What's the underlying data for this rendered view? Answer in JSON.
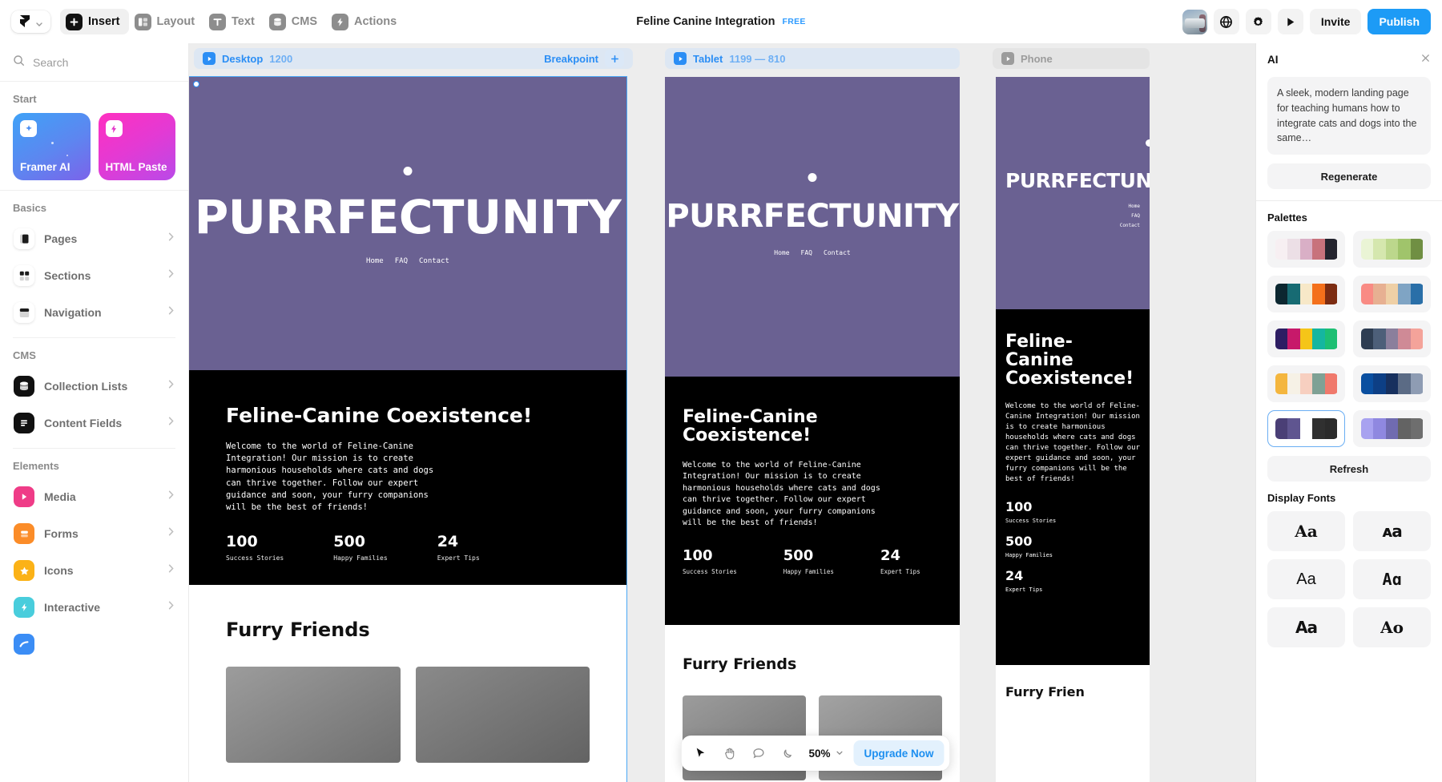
{
  "toolbar": {
    "logo_name": "framer-logo",
    "items": [
      {
        "label": "Insert",
        "icon": "plus-square-icon",
        "active": true
      },
      {
        "label": "Layout",
        "icon": "layout-icon",
        "active": false
      },
      {
        "label": "Text",
        "icon": "text-icon",
        "active": false
      },
      {
        "label": "CMS",
        "icon": "database-icon",
        "active": false
      },
      {
        "label": "Actions",
        "icon": "lightning-icon",
        "active": false
      }
    ],
    "doc_title": "Feline Canine Integration",
    "plan_badge": "FREE",
    "invite_label": "Invite",
    "publish_label": "Publish",
    "right_icons": [
      "avatar",
      "globe-icon",
      "gear-icon",
      "play-icon"
    ]
  },
  "sidebar": {
    "search_placeholder": "Search",
    "sections": [
      {
        "title": "Start",
        "type": "cards",
        "cards": [
          {
            "label": "Framer AI",
            "icon": "sparkle-icon",
            "color": "#4d8ff2"
          },
          {
            "label": "HTML Paste",
            "icon": "lightning-icon",
            "color": "#e336c8"
          }
        ]
      },
      {
        "title": "Basics",
        "type": "list",
        "items": [
          {
            "label": "Pages",
            "icon": "pages-icon",
            "color": "#ffffff"
          },
          {
            "label": "Sections",
            "icon": "sections-icon",
            "color": "#ffffff"
          },
          {
            "label": "Navigation",
            "icon": "navigation-icon",
            "color": "#ffffff"
          }
        ]
      },
      {
        "title": "CMS",
        "type": "list",
        "items": [
          {
            "label": "Collection Lists",
            "icon": "collection-icon",
            "color": "#111111"
          },
          {
            "label": "Content Fields",
            "icon": "content-fields-icon",
            "color": "#111111"
          }
        ]
      },
      {
        "title": "Elements",
        "type": "list",
        "items": [
          {
            "label": "Media",
            "icon": "media-play-icon",
            "color": "#ef3c87"
          },
          {
            "label": "Forms",
            "icon": "forms-icon",
            "color": "#fb8c28"
          },
          {
            "label": "Icons",
            "icon": "star-icon",
            "color": "#fbb217"
          },
          {
            "label": "Interactive",
            "icon": "lightning-icon",
            "color": "#49cddc"
          },
          {
            "label": "",
            "icon": "partial-icon",
            "color": "#3b8df5"
          }
        ]
      }
    ]
  },
  "canvas": {
    "breakpoints": [
      {
        "name": "Desktop",
        "size": "1200",
        "state": "active"
      },
      {
        "name": "Tablet",
        "size": "1199 — 810",
        "state": "active"
      },
      {
        "name": "Phone",
        "size": "",
        "state": "muted"
      }
    ],
    "breakpoint_add_label": "Breakpoint",
    "page": {
      "hero_title": "PURRFECTUNITY",
      "nav": [
        "Home",
        "FAQ",
        "Contact"
      ],
      "heading": "Feline-Canine Coexistence!",
      "heading_tablet_line1": "Feline-Canine",
      "heading_tablet_line2": "Coexistence!",
      "heading_phone": "Feline-Canine Coexistence!",
      "body": "Welcome to the world of Feline-Canine Integration! Our mission is to create harmonious households where cats and dogs can thrive together. Follow our expert guidance and soon, your furry companions will be the best of friends!",
      "stats": [
        {
          "number": "100",
          "label": "Success Stories"
        },
        {
          "number": "500",
          "label": "Happy Families"
        },
        {
          "number": "24",
          "label": "Expert Tips"
        }
      ],
      "section_heading": "Furry Friends",
      "section_heading_phone": "Furry Frien"
    }
  },
  "float_toolbar": {
    "tools": [
      {
        "name": "cursor-icon",
        "active": true
      },
      {
        "name": "hand-icon",
        "active": false
      },
      {
        "name": "comment-icon",
        "active": false
      },
      {
        "name": "moon-icon",
        "active": false
      }
    ],
    "zoom_value": "50%",
    "upgrade_label": "Upgrade Now"
  },
  "ai_panel": {
    "title": "AI",
    "close_icon": "close-icon",
    "prompt_text": "A sleek, modern landing page for teaching humans how to integrate cats and dogs into the same…",
    "regenerate_label": "Regenerate",
    "palettes_title": "Palettes",
    "refresh_label": "Refresh",
    "fonts_title": "Display Fonts",
    "palettes": [
      {
        "colors": [
          "#f7eff2",
          "#ecdfe6",
          "#d9afc6",
          "#c8727c",
          "#24242e"
        ],
        "selected": false
      },
      {
        "colors": [
          "#eaf4d5",
          "#d5e7ae",
          "#bcd78c",
          "#a0c46b",
          "#708f43"
        ],
        "selected": false
      },
      {
        "colors": [
          "#0c2730",
          "#176b73",
          "#f7e8c8",
          "#f4701b",
          "#7c2c12"
        ],
        "selected": false
      },
      {
        "colors": [
          "#f98b84",
          "#e7b092",
          "#efd0a6",
          "#7fa4c4",
          "#2a6fa8"
        ],
        "selected": false
      },
      {
        "colors": [
          "#2d1d63",
          "#c7196a",
          "#f5c518",
          "#15b6a0",
          "#1dbf73"
        ],
        "selected": false
      },
      {
        "colors": [
          "#2e3d52",
          "#4d5f79",
          "#8b7f9c",
          "#cf8a96",
          "#f4a39a"
        ],
        "selected": false
      },
      {
        "colors": [
          "#f4b63f",
          "#f6f1e6",
          "#f7cfc0",
          "#7fa195",
          "#f0796c"
        ],
        "selected": false
      },
      {
        "colors": [
          "#0a4fa0",
          "#0d3f85",
          "#17305e",
          "#5b6b85",
          "#8e9cb3"
        ],
        "selected": false
      },
      {
        "colors": [
          "#4a3f76",
          "#5f5590",
          "#ffffff",
          "#303030",
          "#2b2b2b"
        ],
        "selected": true
      },
      {
        "colors": [
          "#a8a2f0",
          "#8f88e0",
          "#706bb0",
          "#636363",
          "#6e6e6e"
        ],
        "selected": false
      }
    ],
    "fonts": [
      {
        "sample": "Aa",
        "style": "serif"
      },
      {
        "sample": "ᴀa",
        "style": "black"
      },
      {
        "sample": "Aa",
        "style": "sans"
      },
      {
        "sample": "Aɑ",
        "style": "display"
      },
      {
        "sample": "Aa",
        "style": "heavy"
      },
      {
        "sample": "Ao",
        "style": "light"
      }
    ]
  }
}
